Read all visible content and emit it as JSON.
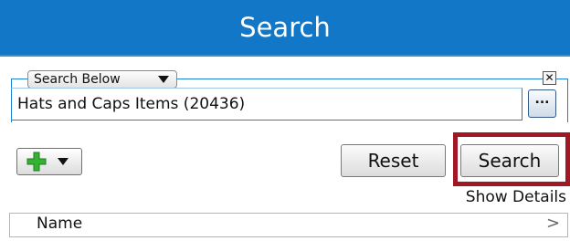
{
  "header": {
    "title": "Search"
  },
  "search_scope": {
    "dropdown_label": "Search Below",
    "field_value": "Hats and Caps Items (20436)",
    "clear_label": "✕",
    "browse_label": "..."
  },
  "toolbar": {
    "reset_label": "Reset",
    "search_label": "Search",
    "show_details_label": "Show Details"
  },
  "results": {
    "columns": [
      {
        "label": "Name"
      }
    ],
    "scroll_label": ">"
  },
  "colors": {
    "header_bg": "#1177c6",
    "group_border": "#1a82d4",
    "highlight": "#a01824",
    "plus_icon": "#33b233"
  },
  "icons": {
    "add": "plus-icon",
    "dropdown": "chevron-down-icon",
    "clear": "close-icon",
    "browse": "ellipsis-icon",
    "columns_more": "chevron-right-icon"
  }
}
